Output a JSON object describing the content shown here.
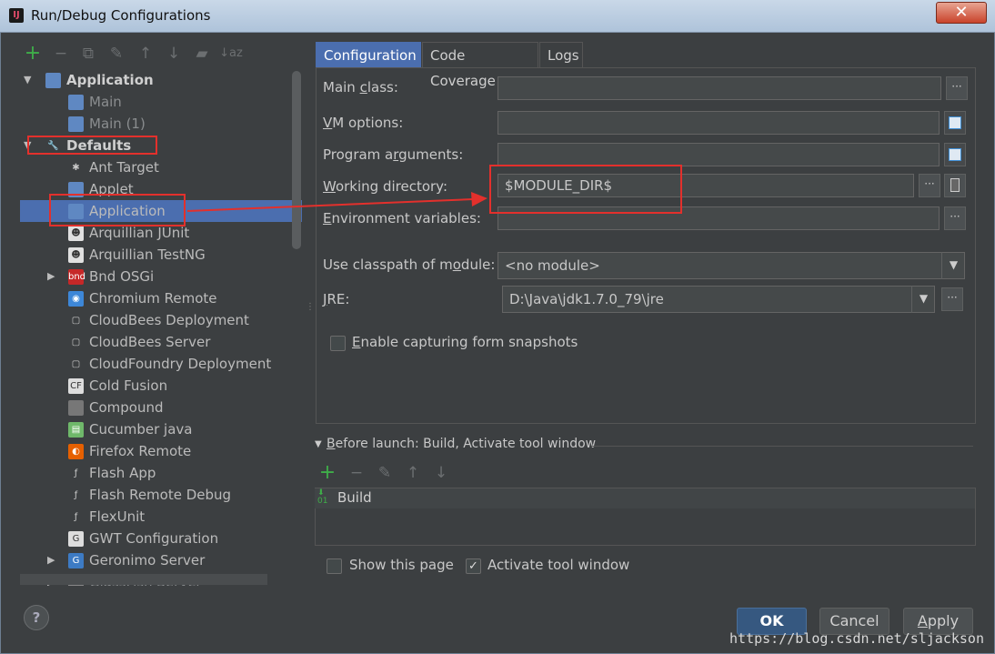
{
  "window": {
    "title": "Run/Debug Configurations",
    "close_label": "✕"
  },
  "toolbar": [
    "+",
    "−",
    "⧉",
    "✎",
    "↑",
    "↓",
    "▰",
    "↓az"
  ],
  "tree": [
    {
      "label": "Application",
      "level": 0,
      "expanded": true,
      "bold": true,
      "icon": "app-icon"
    },
    {
      "label": "Main",
      "level": 1,
      "dim": true,
      "icon": "app-icon"
    },
    {
      "label": "Main (1)",
      "level": 1,
      "dim": true,
      "icon": "app-icon"
    },
    {
      "label": "Defaults",
      "level": 0,
      "expanded": true,
      "bold": true,
      "icon": "wrench-icon"
    },
    {
      "label": "Ant Target",
      "level": 1,
      "icon": "ant-icon"
    },
    {
      "label": "Applet",
      "level": 1,
      "icon": "applet-icon"
    },
    {
      "label": "Application",
      "level": 1,
      "selected": true,
      "icon": "app-icon"
    },
    {
      "label": "Arquillian JUnit",
      "level": 1,
      "icon": "arquillian-icon"
    },
    {
      "label": "Arquillian TestNG",
      "level": 1,
      "icon": "arquillian-icon"
    },
    {
      "label": "Bnd OSGi",
      "level": 1,
      "collapsed": true,
      "icon": "bnd-icon"
    },
    {
      "label": "Chromium Remote",
      "level": 1,
      "icon": "chromium-icon"
    },
    {
      "label": "CloudBees Deployment",
      "level": 1,
      "icon": "cloud-icon"
    },
    {
      "label": "CloudBees Server",
      "level": 1,
      "icon": "cloud-icon"
    },
    {
      "label": "CloudFoundry Deployment",
      "level": 1,
      "icon": "cloud-icon"
    },
    {
      "label": "Cold Fusion",
      "level": 1,
      "icon": "cf-icon"
    },
    {
      "label": "Compound",
      "level": 1,
      "icon": "compound-icon"
    },
    {
      "label": "Cucumber java",
      "level": 1,
      "icon": "cucumber-icon"
    },
    {
      "label": "Firefox Remote",
      "level": 1,
      "icon": "firefox-icon"
    },
    {
      "label": "Flash App",
      "level": 1,
      "icon": "flash-icon"
    },
    {
      "label": "Flash Remote Debug",
      "level": 1,
      "icon": "flash-icon"
    },
    {
      "label": "FlexUnit",
      "level": 1,
      "icon": "flash-icon"
    },
    {
      "label": "GWT Configuration",
      "level": 1,
      "icon": "gwt-icon"
    },
    {
      "label": "Geronimo Server",
      "level": 1,
      "collapsed": true,
      "icon": "geronimo-icon"
    },
    {
      "label": "GlassFish Server",
      "level": 1,
      "collapsed": true,
      "dim": true,
      "icon": "glassfish-icon"
    }
  ],
  "tabs": [
    "Configuration",
    "Code Coverage",
    "Logs"
  ],
  "form": {
    "main_class": {
      "label_pre": "Main ",
      "label_u": "c",
      "label_post": "lass:",
      "value": ""
    },
    "vm_options": {
      "label_pre": "",
      "label_u": "V",
      "label_post": "M options:",
      "value": ""
    },
    "program_args": {
      "label_pre": "Program a",
      "label_u": "r",
      "label_post": "guments:",
      "value": ""
    },
    "working_dir": {
      "label_pre": "",
      "label_u": "W",
      "label_post": "orking directory:",
      "value": "$MODULE_DIR$"
    },
    "env_vars": {
      "label_pre": "",
      "label_u": "E",
      "label_post": "nvironment variables:",
      "value": ""
    },
    "classpath": {
      "label_pre": "Use classpath of m",
      "label_u": "o",
      "label_post": "dule:",
      "value": "<no module>"
    },
    "jre": {
      "label_pre": "",
      "label_u": "J",
      "label_post": "RE:",
      "value": "D:\\Java\\jdk1.7.0_79\\jre"
    },
    "snapshots": {
      "label_pre": "",
      "label_u": "E",
      "label_post": "nable capturing form snapshots",
      "checked": false
    }
  },
  "before_launch": {
    "title_pre": "",
    "title_u": "B",
    "title_post": "efore launch: Build, Activate tool window",
    "toolbar": [
      "+",
      "−",
      "✎",
      "↑",
      "↓"
    ],
    "items": [
      "Build"
    ]
  },
  "options": {
    "show_page": {
      "label": "Show this page",
      "checked": false
    },
    "activate_tool": {
      "label": "Activate tool window",
      "checked": true
    }
  },
  "buttons": {
    "help": "?",
    "ok": "OK",
    "cancel": "Cancel",
    "apply_pre": "",
    "apply_u": "A",
    "apply_post": "pply"
  },
  "watermark": "https://blog.csdn.net/sljackson",
  "colors": {
    "accent": "#4b6eaf",
    "annotation": "#e3302c"
  }
}
